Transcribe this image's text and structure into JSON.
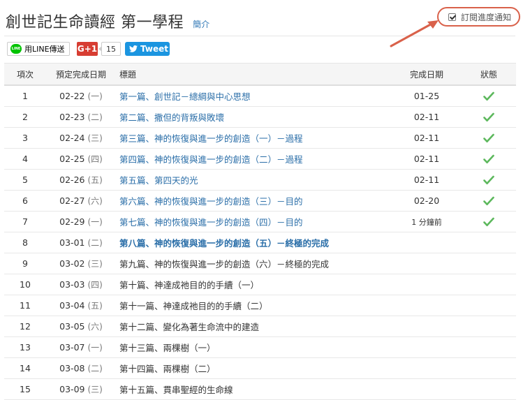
{
  "header": {
    "title": "創世記生命讀經 第一學程",
    "intro_link": "簡介"
  },
  "subscribe": {
    "label": "訂閱進度通知",
    "checked": true
  },
  "share": {
    "line_label": "用LINE傳送",
    "line_logo": "LINE",
    "gplus_label": "G+1",
    "gplus_count": "15",
    "tweet_label": "Tweet"
  },
  "table": {
    "headers": [
      "項次",
      "預定完成日期",
      "標題",
      "完成日期",
      "狀態"
    ],
    "rows": [
      {
        "num": "1",
        "date": "02-22",
        "weekday": "(一)",
        "title": "第一篇、創世記－總綱與中心思想",
        "title_style": "link",
        "done": "01-25",
        "status": "check"
      },
      {
        "num": "2",
        "date": "02-23",
        "weekday": "(二)",
        "title": "第二篇、撒但的背叛與敗壞",
        "title_style": "link",
        "done": "02-11",
        "status": "check"
      },
      {
        "num": "3",
        "date": "02-24",
        "weekday": "(三)",
        "title": "第三篇、神的恢復與進一步的創造（一）－過程",
        "title_style": "link",
        "done": "02-11",
        "status": "check"
      },
      {
        "num": "4",
        "date": "02-25",
        "weekday": "(四)",
        "title": "第四篇、神的恢復與進一步的創造（二）－過程",
        "title_style": "link",
        "done": "02-11",
        "status": "check"
      },
      {
        "num": "5",
        "date": "02-26",
        "weekday": "(五)",
        "title": "第五篇、第四天的光",
        "title_style": "link",
        "done": "02-11",
        "status": "check"
      },
      {
        "num": "6",
        "date": "02-27",
        "weekday": "(六)",
        "title": "第六篇、神的恢復與進一步的創造（三）－目的",
        "title_style": "link",
        "done": "02-20",
        "status": "check"
      },
      {
        "num": "7",
        "date": "02-29",
        "weekday": "(一)",
        "title": "第七篇、神的恢復與進一步的創造（四）－目的",
        "title_style": "link",
        "done": "1 分鐘前",
        "status": "check"
      },
      {
        "num": "8",
        "date": "03-01",
        "weekday": "(二)",
        "title": "第八篇、神的恢復與進一步的創造（五）－終極的完成",
        "title_style": "bold",
        "done": "",
        "status": ""
      },
      {
        "num": "9",
        "date": "03-02",
        "weekday": "(三)",
        "title": "第九篇、神的恢復與進一步的創造（六）－終極的完成",
        "title_style": "plain",
        "done": "",
        "status": ""
      },
      {
        "num": "10",
        "date": "03-03",
        "weekday": "(四)",
        "title": "第十篇、神達成祂目的的手續（一）",
        "title_style": "plain",
        "done": "",
        "status": ""
      },
      {
        "num": "11",
        "date": "03-04",
        "weekday": "(五)",
        "title": "第十一篇、神達成祂目的的手續（二）",
        "title_style": "plain",
        "done": "",
        "status": ""
      },
      {
        "num": "12",
        "date": "03-05",
        "weekday": "(六)",
        "title": "第十二篇、變化為著生命流中的建造",
        "title_style": "plain",
        "done": "",
        "status": ""
      },
      {
        "num": "13",
        "date": "03-07",
        "weekday": "(一)",
        "title": "第十三篇、兩棵樹（一）",
        "title_style": "plain",
        "done": "",
        "status": ""
      },
      {
        "num": "14",
        "date": "03-08",
        "weekday": "(二)",
        "title": "第十四篇、兩棵樹（二）",
        "title_style": "plain",
        "done": "",
        "status": ""
      },
      {
        "num": "15",
        "date": "03-09",
        "weekday": "(三)",
        "title": "第十五篇、貫串聖經的生命線",
        "title_style": "plain",
        "done": "",
        "status": ""
      }
    ]
  },
  "colors": {
    "link": "#2a6ea8",
    "check": "#5cb85c",
    "annotation": "#d9614a",
    "gplus": "#d73d32",
    "twitter": "#1b95e0",
    "line": "#00c300"
  }
}
